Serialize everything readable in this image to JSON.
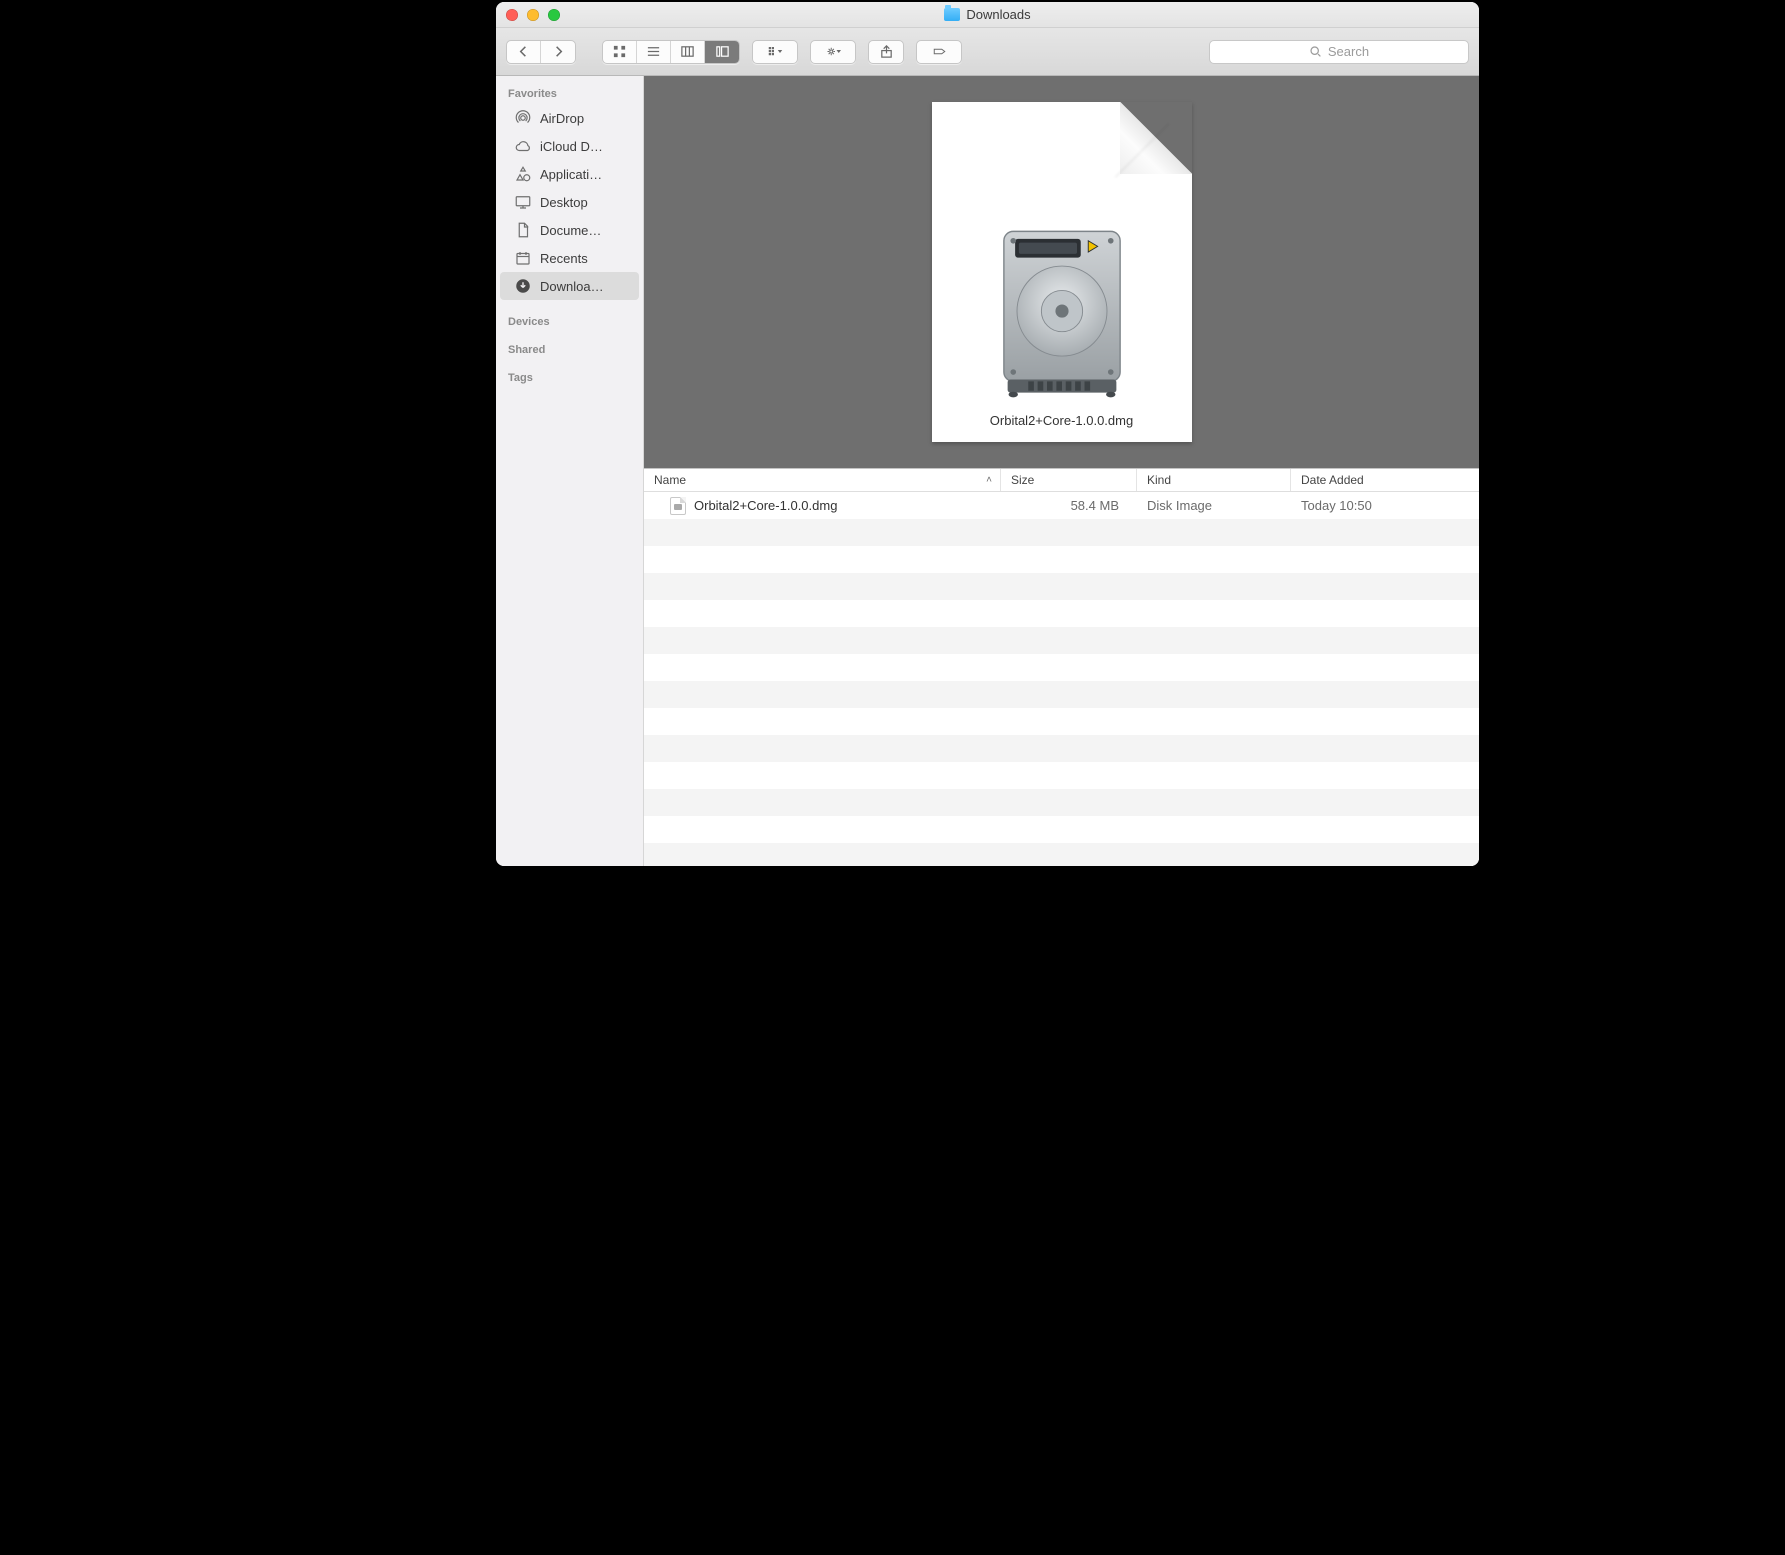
{
  "window": {
    "title": "Downloads"
  },
  "toolbar": {
    "search_placeholder": "Search"
  },
  "sidebar": {
    "sections": {
      "favorites": "Favorites",
      "devices": "Devices",
      "shared": "Shared",
      "tags": "Tags"
    },
    "items": [
      {
        "label": "AirDrop",
        "icon": "airdrop"
      },
      {
        "label": "iCloud D…",
        "icon": "cloud"
      },
      {
        "label": "Applicati…",
        "icon": "apps"
      },
      {
        "label": "Desktop",
        "icon": "desktop"
      },
      {
        "label": "Docume…",
        "icon": "document"
      },
      {
        "label": "Recents",
        "icon": "recents"
      },
      {
        "label": "Downloa…",
        "icon": "downloads",
        "selected": true
      }
    ]
  },
  "preview": {
    "filename": "Orbital2+Core-1.0.0.dmg"
  },
  "list": {
    "columns": {
      "name": "Name",
      "size": "Size",
      "kind": "Kind",
      "date_added": "Date Added"
    },
    "sort_column": "name",
    "sort_dir": "asc",
    "rows": [
      {
        "name": "Orbital2+Core-1.0.0.dmg",
        "size": "58.4 MB",
        "kind": "Disk Image",
        "date_added": "Today 10:50"
      }
    ]
  }
}
